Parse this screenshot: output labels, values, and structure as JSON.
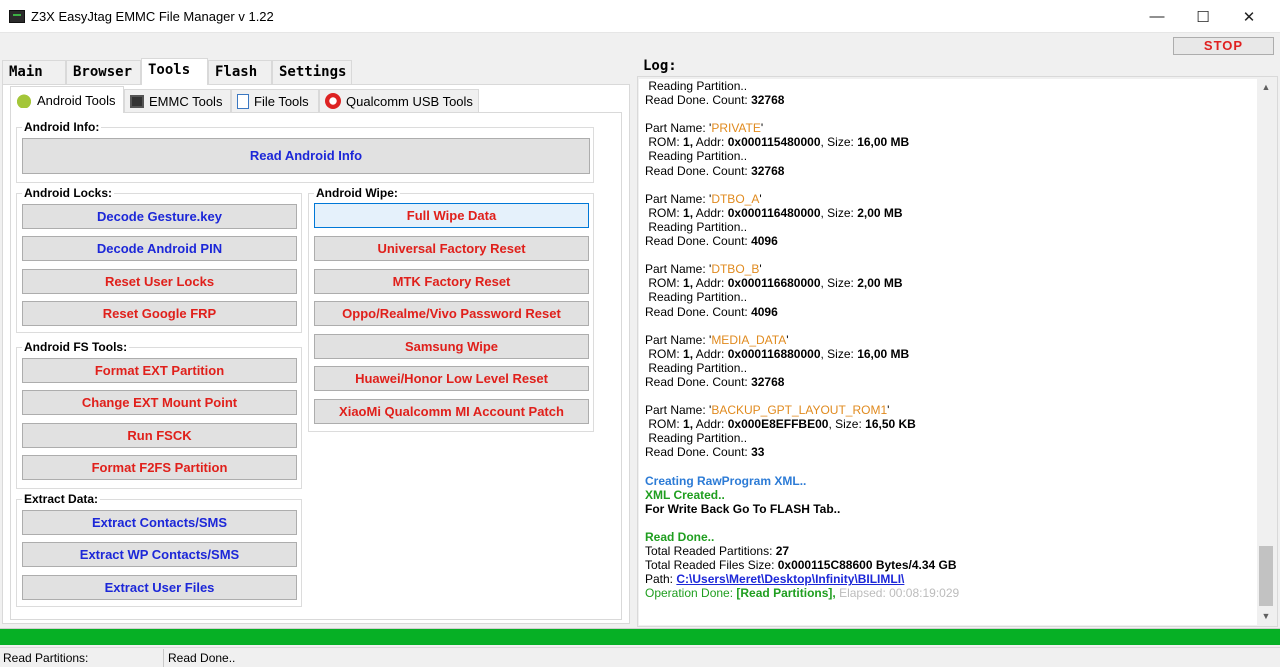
{
  "window": {
    "title": "Z3X EasyJtag EMMC File Manager v 1.22",
    "minimize": "—",
    "maximize": "☐",
    "close": "✕"
  },
  "stop_label": "STOP",
  "main_tabs": [
    "Main",
    "Browser",
    "Tools",
    "Flash",
    "Settings"
  ],
  "main_tab_active": "Tools",
  "sub_tabs": [
    {
      "label": "Android Tools",
      "icon": "android-icon"
    },
    {
      "label": "EMMC Tools",
      "icon": "chip-icon"
    },
    {
      "label": "File Tools",
      "icon": "file-icon"
    },
    {
      "label": "Qualcomm USB Tools",
      "icon": "qualcomm-icon"
    }
  ],
  "android_info": {
    "label": "Android Info:",
    "read_button": "Read Android Info"
  },
  "android_locks": {
    "label": "Android Locks:",
    "buttons": [
      "Decode Gesture.key",
      "Decode Android PIN",
      "Reset User Locks",
      "Reset Google FRP"
    ]
  },
  "android_fs_tools": {
    "label": "Android FS Tools:",
    "buttons": [
      "Format EXT Partition",
      "Change EXT Mount Point",
      "Run FSCK",
      "Format F2FS Partition"
    ]
  },
  "extract_data": {
    "label": "Extract Data:",
    "buttons": [
      "Extract Contacts/SMS",
      "Extract WP Contacts/SMS",
      "Extract User Files"
    ]
  },
  "android_wipe": {
    "label": "Android Wipe:",
    "buttons": [
      "Full Wipe Data",
      "Universal Factory Reset",
      "MTK Factory Reset",
      "Oppo/Realme/Vivo Password Reset",
      "Samsung Wipe",
      "Huawei/Honor Low Level Reset",
      "XiaoMi Qualcomm MI Account Patch"
    ]
  },
  "log": {
    "label": "Log:",
    "top": {
      "reading": "Reading Partition..",
      "read_done": "Read Done. Count: ",
      "count": "32768"
    },
    "partitions": [
      {
        "name": "PRIVATE",
        "rom": "1",
        "addr": "0x000115480000",
        "size": "16,00 MB",
        "count": "32768"
      },
      {
        "name": "DTBO_A",
        "rom": "1",
        "addr": "0x000116480000",
        "size": "2,00 MB",
        "count": "4096"
      },
      {
        "name": "DTBO_B",
        "rom": "1",
        "addr": "0x000116680000",
        "size": "2,00 MB",
        "count": "4096"
      },
      {
        "name": "MEDIA_DATA",
        "rom": "1",
        "addr": "0x000116880000",
        "size": "16,00 MB",
        "count": "32768"
      },
      {
        "name": "BACKUP_GPT_LAYOUT_ROM1",
        "rom": "1",
        "addr": "0x000E8EFFBE00",
        "size": "16,50 KB",
        "count": "33"
      }
    ],
    "creating": "Creating RawProgram XML..",
    "xml_created": "XML Created..",
    "write_back": "For Write Back Go To FLASH Tab..",
    "read_done_final": "Read Done..",
    "total_partitions_label": "Total Readed Partitions: ",
    "total_partitions": "27",
    "total_size_label": "Total Readed Files Size: ",
    "total_size": "0x000115C88600 Bytes/4.34 GB",
    "path_label": "Path: ",
    "path": "C:\\Users\\Meret\\Desktop\\Infinity\\BILIMLI\\",
    "op_done": "Operation Done: ",
    "op_detail": "[Read Partitions],",
    "elapsed": " Elapsed: 00:08:19:029"
  },
  "progress_fraction": 1.0,
  "status": {
    "left": "Read Partitions:",
    "right": "Read Done.."
  },
  "colors": {
    "progress": "#06b025",
    "blue_button": "#1c27d8",
    "red_button": "#e0201b",
    "partition_name": "#e08a1e"
  }
}
